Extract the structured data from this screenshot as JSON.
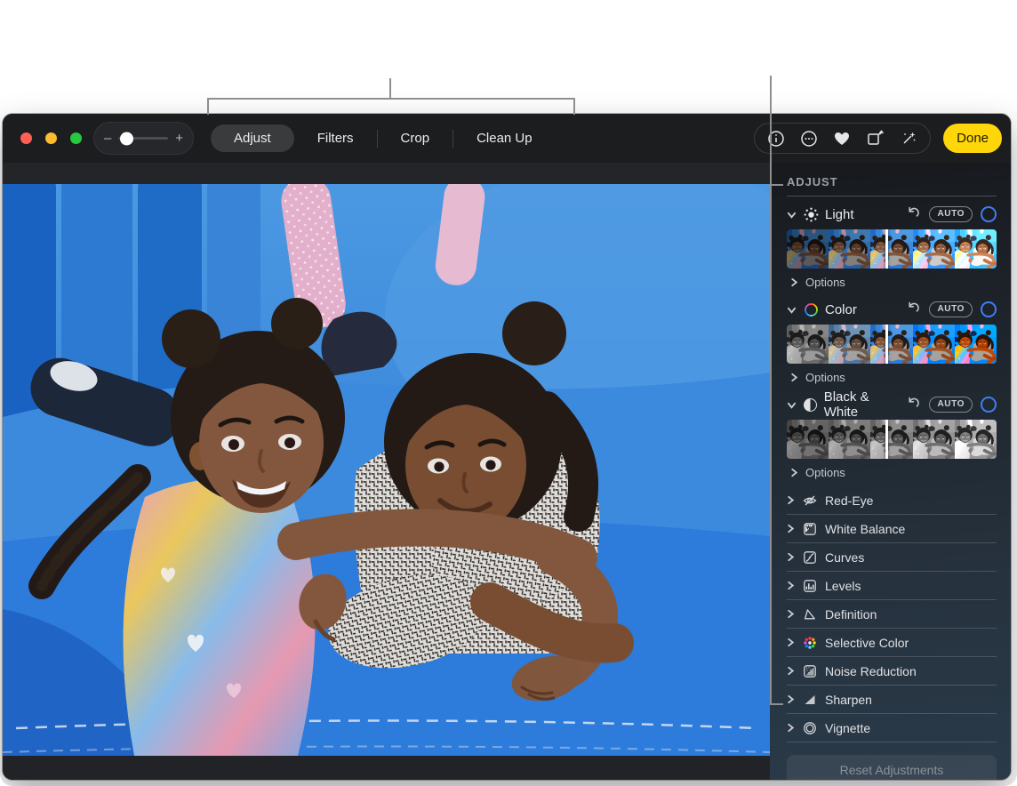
{
  "toolbar": {
    "window_controls": [
      "close",
      "minimize",
      "fullscreen"
    ],
    "zoom_slider": {
      "minus_label": "–",
      "plus_label": "+"
    },
    "tabs": [
      {
        "label": "Adjust",
        "selected": true
      },
      {
        "label": "Filters",
        "selected": false
      },
      {
        "label": "Crop",
        "selected": false
      },
      {
        "label": "Clean Up",
        "selected": false
      }
    ],
    "action_icons": [
      "info-icon",
      "more-icon",
      "favorite-icon",
      "rotate-icon",
      "auto-enhance-icon"
    ],
    "done_label": "Done"
  },
  "sidebar": {
    "header": "ADJUST",
    "sections": [
      {
        "label": "Light",
        "icon": "sun-icon",
        "auto_label": "AUTO",
        "options_label": "Options",
        "expanded": true
      },
      {
        "label": "Color",
        "icon": "color-wheel-icon",
        "auto_label": "AUTO",
        "options_label": "Options",
        "expanded": true
      },
      {
        "label": "Black & White",
        "icon": "half-circle-icon",
        "auto_label": "AUTO",
        "options_label": "Options",
        "expanded": true
      }
    ],
    "tools": [
      {
        "label": "Red-Eye",
        "icon": "red-eye-icon"
      },
      {
        "label": "White Balance",
        "icon": "white-balance-icon"
      },
      {
        "label": "Curves",
        "icon": "curves-icon"
      },
      {
        "label": "Levels",
        "icon": "levels-icon"
      },
      {
        "label": "Definition",
        "icon": "definition-icon"
      },
      {
        "label": "Selective Color",
        "icon": "selective-color-icon"
      },
      {
        "label": "Noise Reduction",
        "icon": "noise-reduction-icon"
      },
      {
        "label": "Sharpen",
        "icon": "sharpen-icon"
      },
      {
        "label": "Vignette",
        "icon": "vignette-icon"
      }
    ],
    "reset_label": "Reset Adjustments"
  },
  "colors": {
    "done_button": "#FFD60A",
    "accent_blue": "#3D7DF5",
    "annotation_gray": "#8E8E8E",
    "traffic_red": "#FF5F57",
    "traffic_yellow": "#FEBC2E",
    "traffic_green": "#28C840"
  }
}
